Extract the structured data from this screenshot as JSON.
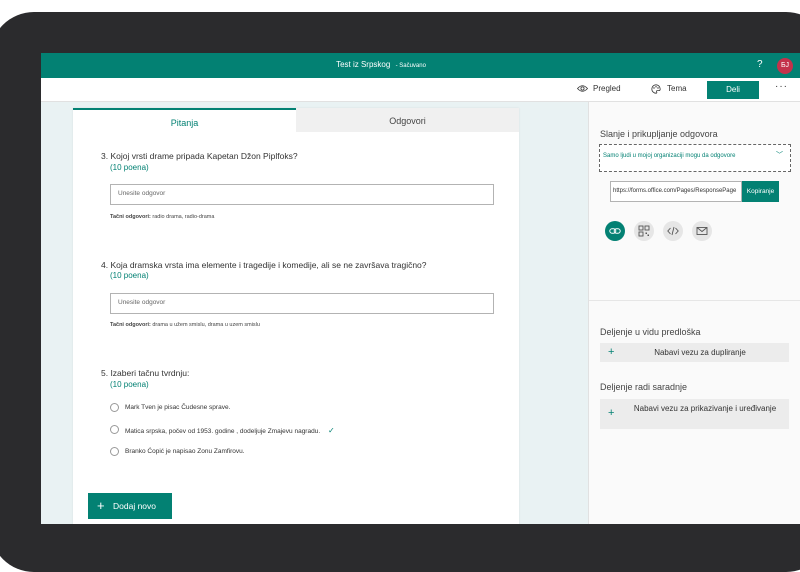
{
  "app": {
    "title": "Test iz Srpskog",
    "saved_status": "- Sačuvano",
    "help_label": "?",
    "avatar_initials": "БЈ",
    "accent_color": "#038173"
  },
  "toolbar": {
    "preview_label": "Pregled",
    "theme_label": "Tema",
    "share_label": "Deli",
    "more_label": "···"
  },
  "tabs": {
    "questions": "Pitanja",
    "responses": "Odgovori"
  },
  "questions": [
    {
      "title": "3. Kojoj vrsti drame pripada Kapetan Džon Piplfoks?",
      "points": "(10 poena)",
      "placeholder": "Unesite odgovor",
      "correct_label": "Tačni odgovori:",
      "correct_answers": "radio drama, radio-drama"
    },
    {
      "title": "4. Koja dramska vrsta ima elemente i tragedije i komedije, ali se ne završava tragično?",
      "points": "(10 poena)",
      "placeholder": "Unesite odgovor",
      "correct_label": "Tačni odgovori:",
      "correct_answers": "drama u užem smislu, drama u uzem smislu"
    },
    {
      "title": "5. Izaberi tačnu tvrdnju:",
      "points": "(10 poena)",
      "options": [
        {
          "text": "Mark Tven je pisac Čudesne sprave.",
          "correct": false
        },
        {
          "text": "Matica srpska, počev od 1953. godine , dodeljuje Zmajevu nagradu.",
          "correct": true
        },
        {
          "text": "Branko Ćopić je napisao Zonu Zamfirovu.",
          "correct": false
        }
      ]
    }
  ],
  "add_new_label": "Dodaj novo",
  "share_panel": {
    "title": "Slanje i prikupljanje odgovora",
    "audience_selected": "Samo ljudi u mojoj organizaciji mogu da odgovore",
    "link_value": "https://forms.office.com/Pages/ResponsePage",
    "copy_label": "Kopiranje",
    "icons": [
      "link-icon",
      "qr-code-icon",
      "embed-icon",
      "email-icon"
    ],
    "template_title": "Deljenje u vidu predloška",
    "template_button": "Nabavi vezu za dupliranje",
    "collab_title": "Deljenje radi saradnje",
    "collab_button": "Nabavi vezu za prikazivanje i uređivanje"
  }
}
